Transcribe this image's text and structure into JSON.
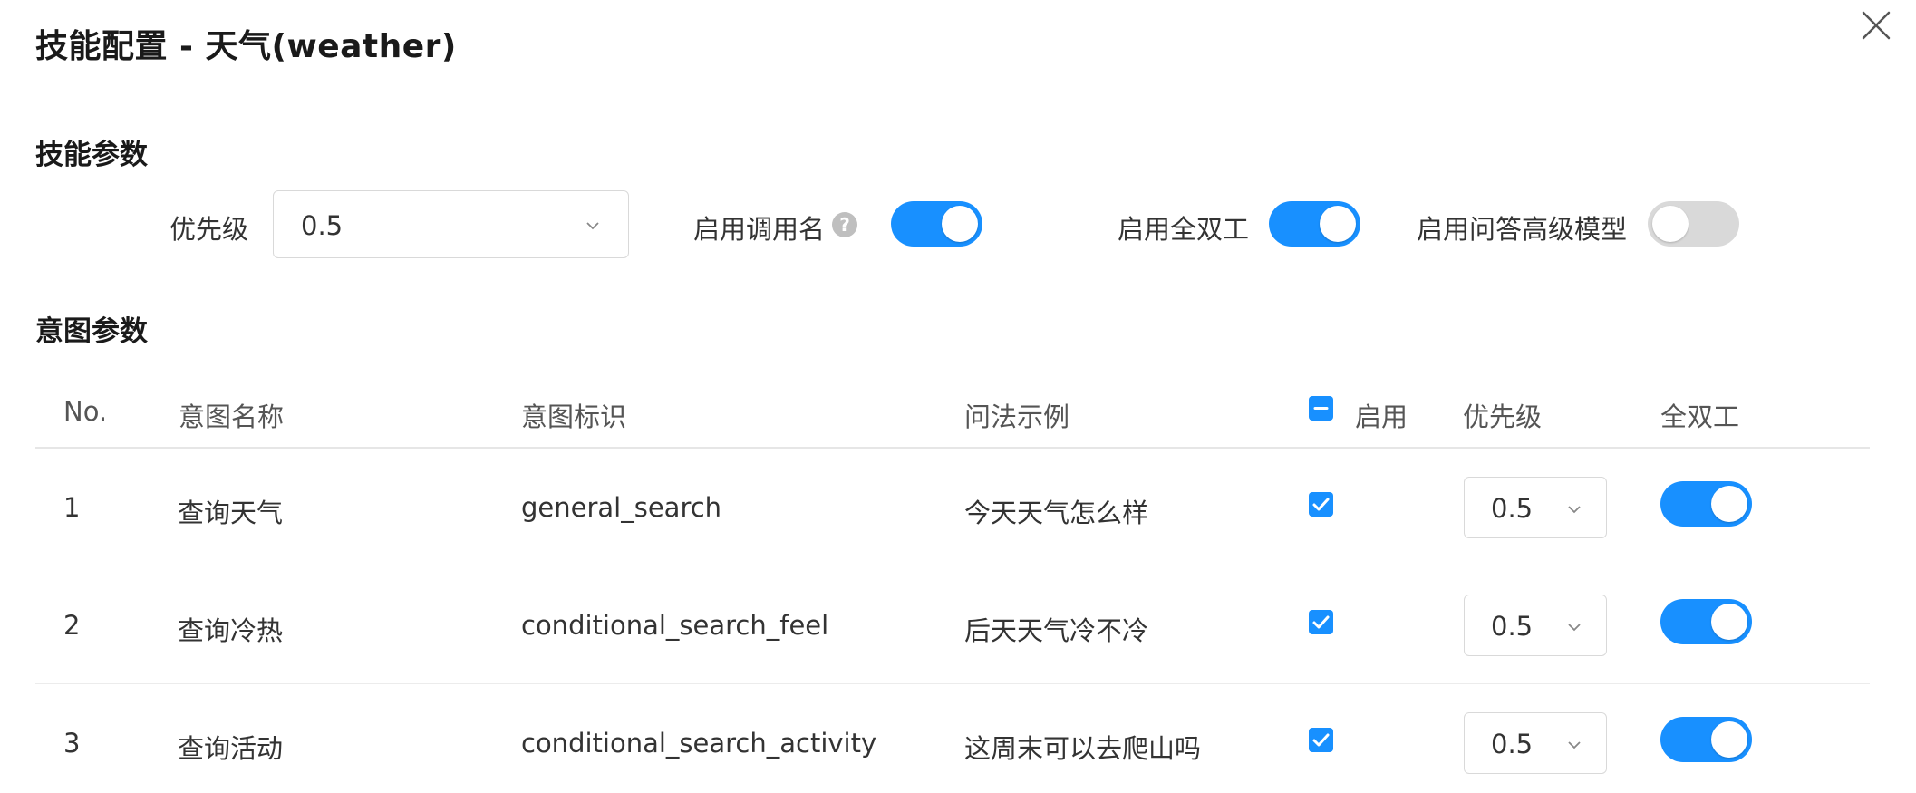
{
  "dialog": {
    "title": "技能配置 - 天气(weather)"
  },
  "skill_params": {
    "section_title": "技能参数",
    "priority_label": "优先级",
    "priority_value": "0.5",
    "call_name_label": "启用调用名",
    "call_name_enabled": true,
    "full_duplex_label": "启用全双工",
    "full_duplex_enabled": true,
    "qa_model_label": "启用问答高级模型",
    "qa_model_enabled": false
  },
  "intent_params": {
    "section_title": "意图参数",
    "columns": {
      "no": "No.",
      "name": "意图名称",
      "id": "意图标识",
      "example": "问法示例",
      "enable": "启用",
      "priority": "优先级",
      "duplex": "全双工"
    },
    "rows": [
      {
        "no": "1",
        "name": "查询天气",
        "id": "general_search",
        "example": "今天天气怎么样",
        "enabled": true,
        "priority": "0.5",
        "duplex": true
      },
      {
        "no": "2",
        "name": "查询冷热",
        "id": "conditional_search_feel",
        "example": "后天天气冷不冷",
        "enabled": true,
        "priority": "0.5",
        "duplex": true
      },
      {
        "no": "3",
        "name": "查询活动",
        "id": "conditional_search_activity",
        "example": "这周末可以去爬山吗",
        "enabled": true,
        "priority": "0.5",
        "duplex": true
      }
    ]
  },
  "colors": {
    "accent": "#1890ff",
    "switch_off": "#d9d9d9"
  },
  "icons": {
    "close": "close-icon",
    "help": "question-circle-icon",
    "dropdown": "chevron-down-icon",
    "check": "check-icon",
    "indeterminate": "minus-icon"
  }
}
